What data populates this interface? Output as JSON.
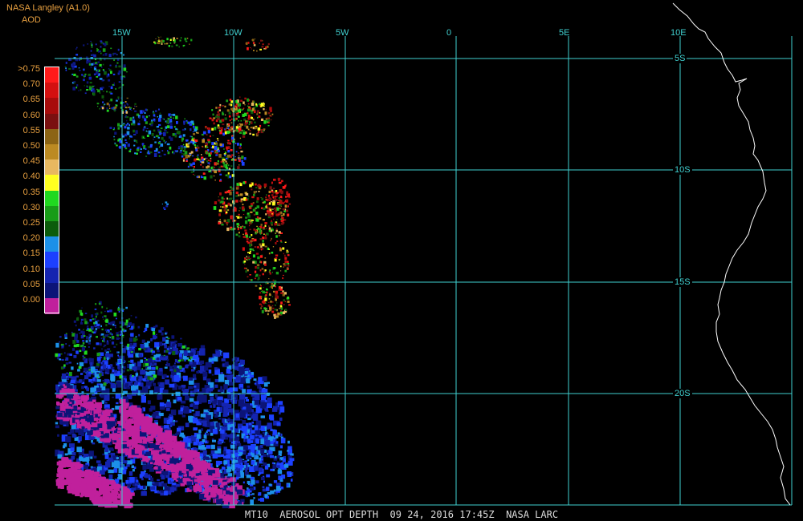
{
  "header": {
    "producer": "NASA Langley (A1.0)",
    "variable": "AOD"
  },
  "legend": {
    "entries": [
      {
        "label": ">0.75",
        "color": "#ff1a1a"
      },
      {
        "label": "0.70",
        "color": "#d41010"
      },
      {
        "label": "0.65",
        "color": "#a80c0c"
      },
      {
        "label": "0.60",
        "color": "#7a1010"
      },
      {
        "label": "0.55",
        "color": "#8c6414"
      },
      {
        "label": "0.50",
        "color": "#bc8a22"
      },
      {
        "label": "0.45",
        "color": "#e8b860"
      },
      {
        "label": "0.40",
        "color": "#ffff20"
      },
      {
        "label": "0.35",
        "color": "#20d820"
      },
      {
        "label": "0.30",
        "color": "#189c18"
      },
      {
        "label": "0.25",
        "color": "#0c5c0c"
      },
      {
        "label": "0.20",
        "color": "#1c90e8"
      },
      {
        "label": "0.15",
        "color": "#1c40ff"
      },
      {
        "label": "0.10",
        "color": "#1424b0"
      },
      {
        "label": "0.05",
        "color": "#0c1478"
      },
      {
        "label": "0.00",
        "color": "#c0209c"
      }
    ]
  },
  "grid": {
    "line_color": "#40d0d0",
    "lon_labels": [
      "15W",
      "10W",
      "5W",
      "0",
      "5E",
      "10E"
    ],
    "lat_labels": [
      "5S",
      "10S",
      "15S",
      "20S"
    ]
  },
  "coastline_color": "#ffffff",
  "footer": {
    "product": "MT10",
    "title": "AEROSOL OPT DEPTH",
    "date": "09 24, 2016",
    "time": "17:45Z",
    "source": "NASA LARC"
  }
}
